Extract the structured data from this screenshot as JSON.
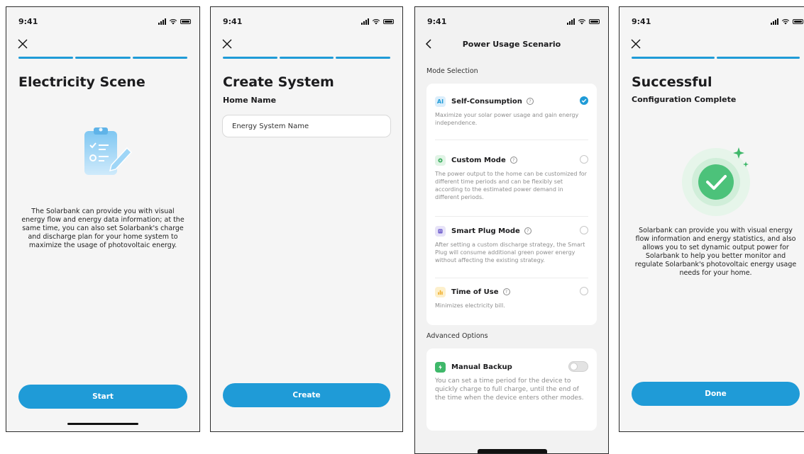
{
  "screens": {
    "electricity": {
      "time": "9:41",
      "title": "Electricity Scene",
      "body": "The Solarbank can provide you with visual energy flow and energy data information; at the same time, you can also set Solarbank's charge and discharge plan for your home system to maximize the usage of photovoltaic energy.",
      "button": "Start"
    },
    "create": {
      "time": "9:41",
      "title": "Create System",
      "field_label": "Home Name",
      "field_value": "Energy System Name",
      "button": "Create"
    },
    "scenario": {
      "time": "9:41",
      "title": "Power Usage Scenario",
      "mode_section": "Mode Selection",
      "modes": [
        {
          "name": "Self-Consumption",
          "icon": "ai-icon",
          "icon_text": "AI",
          "selected": true,
          "desc": "Maximize your solar power usage and gain energy independence."
        },
        {
          "name": "Custom Mode",
          "icon": "gear-icon",
          "selected": false,
          "desc": "The power output to the home can be customized for different time periods and can be flexibly set according to the estimated power demand in different periods."
        },
        {
          "name": "Smart Plug Mode",
          "icon": "smart-plug-icon",
          "selected": false,
          "desc": "After setting a custom discharge strategy, the Smart Plug will consume additional green power energy without affecting the existing strategy."
        },
        {
          "name": "Time of Use",
          "icon": "bar-chart-icon",
          "selected": false,
          "desc": "Minimizes electricity bill."
        }
      ],
      "advanced_section": "Advanced Options",
      "backup": {
        "name": "Manual Backup",
        "icon": "lightning-icon",
        "enabled": false,
        "desc": "You can set a time period for the device to quickly charge to full charge, until the end of the time when the device enters other modes."
      }
    },
    "success": {
      "time": "9:41",
      "title": "Successful",
      "subtitle": "Configuration Complete",
      "body": "Solarbank can provide you with visual energy flow information and energy statistics, and also allows you to set dynamic output power for Solarbank to help you better monitor and regulate Solarbank's photovoltaic energy usage needs for your home.",
      "button": "Done"
    }
  },
  "colors": {
    "accent": "#1f9bd7",
    "success_green": "#4cc27a",
    "background": "#f5f5f5"
  }
}
